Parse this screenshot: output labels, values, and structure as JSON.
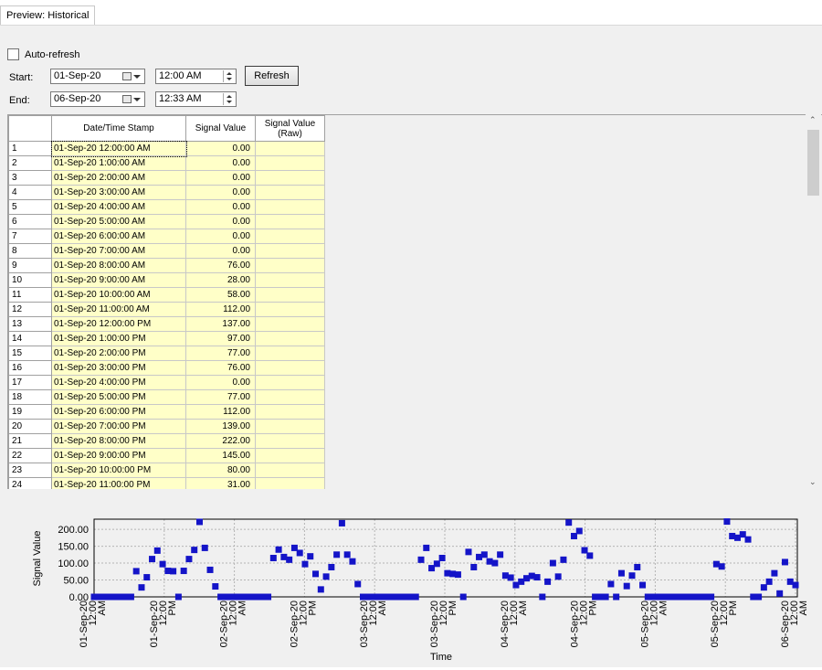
{
  "tab": {
    "label": "Preview: Historical"
  },
  "controls": {
    "auto_refresh": "Auto-refresh",
    "start_label": "Start:",
    "end_label": "End:",
    "start_date": "01-Sep-20",
    "start_time": "12:00 AM",
    "end_date": "06-Sep-20",
    "end_time": "12:33 AM",
    "refresh": "Refresh"
  },
  "table": {
    "columns": [
      "Date/Time Stamp",
      "Signal Value",
      "Signal Value (Raw)"
    ],
    "rows": [
      [
        "1",
        "01-Sep-20 12:00:00 AM",
        "0.00"
      ],
      [
        "2",
        "01-Sep-20 1:00:00 AM",
        "0.00"
      ],
      [
        "3",
        "01-Sep-20 2:00:00 AM",
        "0.00"
      ],
      [
        "4",
        "01-Sep-20 3:00:00 AM",
        "0.00"
      ],
      [
        "5",
        "01-Sep-20 4:00:00 AM",
        "0.00"
      ],
      [
        "6",
        "01-Sep-20 5:00:00 AM",
        "0.00"
      ],
      [
        "7",
        "01-Sep-20 6:00:00 AM",
        "0.00"
      ],
      [
        "8",
        "01-Sep-20 7:00:00 AM",
        "0.00"
      ],
      [
        "9",
        "01-Sep-20 8:00:00 AM",
        "76.00"
      ],
      [
        "10",
        "01-Sep-20 9:00:00 AM",
        "28.00"
      ],
      [
        "11",
        "01-Sep-20 10:00:00 AM",
        "58.00"
      ],
      [
        "12",
        "01-Sep-20 11:00:00 AM",
        "112.00"
      ],
      [
        "13",
        "01-Sep-20 12:00:00 PM",
        "137.00"
      ],
      [
        "14",
        "01-Sep-20 1:00:00 PM",
        "97.00"
      ],
      [
        "15",
        "01-Sep-20 2:00:00 PM",
        "77.00"
      ],
      [
        "16",
        "01-Sep-20 3:00:00 PM",
        "76.00"
      ],
      [
        "17",
        "01-Sep-20 4:00:00 PM",
        "0.00"
      ],
      [
        "18",
        "01-Sep-20 5:00:00 PM",
        "77.00"
      ],
      [
        "19",
        "01-Sep-20 6:00:00 PM",
        "112.00"
      ],
      [
        "20",
        "01-Sep-20 7:00:00 PM",
        "139.00"
      ],
      [
        "21",
        "01-Sep-20 8:00:00 PM",
        "222.00"
      ],
      [
        "22",
        "01-Sep-20 9:00:00 PM",
        "145.00"
      ],
      [
        "23",
        "01-Sep-20 10:00:00 PM",
        "80.00"
      ],
      [
        "24",
        "01-Sep-20 11:00:00 PM",
        "31.00"
      ]
    ]
  },
  "chart_data": {
    "type": "scatter",
    "xlabel": "Time",
    "ylabel": "Signal Value",
    "ylim": [
      0,
      230
    ],
    "yticks": [
      "0.00",
      "50.00",
      "100.00",
      "150.00",
      "200.00"
    ],
    "xticks": [
      [
        "01-Sep-20",
        "12:00",
        "AM"
      ],
      [
        "01-Sep-20",
        "12:00",
        "PM"
      ],
      [
        "02-Sep-20",
        "12:00",
        "AM"
      ],
      [
        "02-Sep-20",
        "12:00",
        "PM"
      ],
      [
        "03-Sep-20",
        "12:00",
        "AM"
      ],
      [
        "03-Sep-20",
        "12:00",
        "PM"
      ],
      [
        "04-Sep-20",
        "12:00",
        "AM"
      ],
      [
        "04-Sep-20",
        "12:00",
        "PM"
      ],
      [
        "05-Sep-20",
        "12:00",
        "AM"
      ],
      [
        "05-Sep-20",
        "12:00",
        "PM"
      ],
      [
        "06-Sep-20",
        "12:00",
        "AM"
      ]
    ],
    "x_start": "01-Sep-20 12:00 AM",
    "x_interval": "1 hour",
    "grid": true,
    "values": [
      0,
      0,
      0,
      0,
      0,
      0,
      0,
      0,
      76,
      28,
      58,
      112,
      137,
      97,
      77,
      76,
      0,
      77,
      112,
      139,
      222,
      145,
      80,
      31,
      0,
      0,
      0,
      0,
      0,
      0,
      0,
      0,
      0,
      0,
      115,
      140,
      118,
      110,
      145,
      130,
      97,
      120,
      68,
      22,
      60,
      88,
      125,
      218,
      125,
      105,
      38,
      0,
      0,
      0,
      0,
      0,
      0,
      0,
      0,
      0,
      0,
      0,
      110,
      145,
      85,
      98,
      115,
      70,
      68,
      66,
      0,
      133,
      88,
      118,
      125,
      105,
      100,
      125,
      63,
      57,
      35,
      45,
      55,
      62,
      58,
      0,
      45,
      100,
      60,
      110,
      220,
      180,
      195,
      138,
      122,
      0,
      0,
      0,
      38,
      0,
      70,
      32,
      63,
      88,
      35,
      0,
      0,
      0,
      0,
      0,
      0,
      0,
      0,
      0,
      0,
      0,
      0,
      0,
      97,
      90,
      223,
      180,
      175,
      185,
      170,
      0,
      0,
      28,
      45,
      70,
      10,
      103,
      45,
      35
    ]
  }
}
